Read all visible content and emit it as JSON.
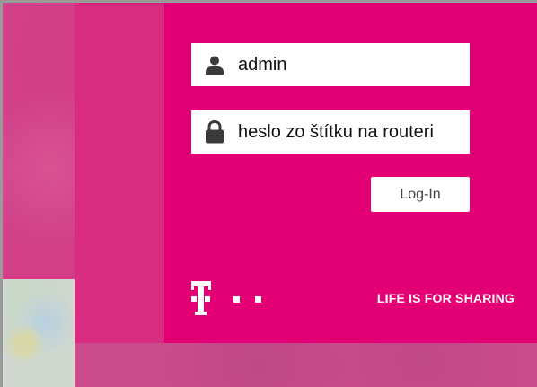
{
  "login": {
    "username_value": "admin",
    "password_value": "heslo zo štítku na routeri",
    "login_button_label": "Log-In"
  },
  "brand": {
    "slogan": "LIFE IS FOR SHARING",
    "logo_name": "telekom-t-logo",
    "accent_color": "#e20074"
  },
  "icons": {
    "user_icon": "user-icon",
    "lock_icon": "lock-icon"
  }
}
